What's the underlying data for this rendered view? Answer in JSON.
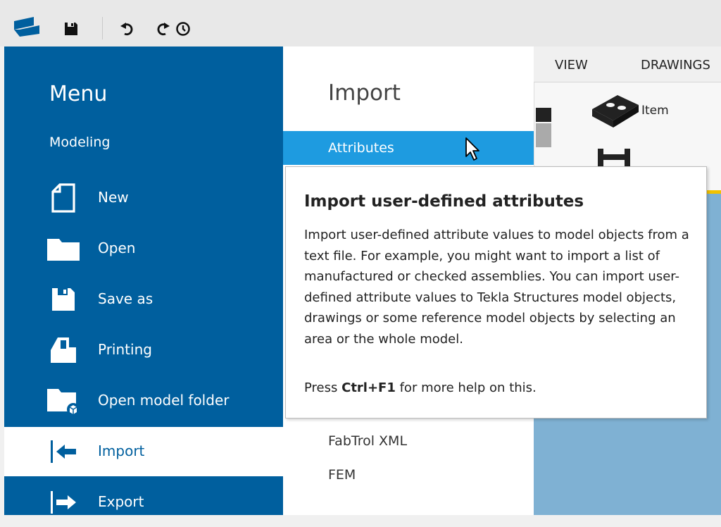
{
  "quick_access": {
    "logo": "tekla-logo-icon",
    "icons": [
      "save-icon",
      "undo-icon",
      "redo-icon",
      "history-icon"
    ]
  },
  "menu": {
    "title": "Menu",
    "subtitle": "Modeling",
    "items": [
      {
        "label": "New",
        "icon": "new-file-icon"
      },
      {
        "label": "Open",
        "icon": "folder-icon"
      },
      {
        "label": "Save as",
        "icon": "save-icon"
      },
      {
        "label": "Printing",
        "icon": "printer-icon"
      },
      {
        "label": "Open model folder",
        "icon": "model-folder-icon"
      },
      {
        "label": "Import",
        "icon": "import-arrow-icon",
        "active": true
      },
      {
        "label": "Export",
        "icon": "export-arrow-icon"
      }
    ]
  },
  "submenu": {
    "title": "Import",
    "items": [
      {
        "label": "Attributes",
        "highlighted": true
      },
      {
        "label": "FabTrol XML"
      },
      {
        "label": "FEM"
      }
    ]
  },
  "ribbon": {
    "tabs": [
      "VIEW",
      "DRAWINGS"
    ],
    "buttons": [
      {
        "label": "Item",
        "icon": "item-block-icon"
      }
    ]
  },
  "tooltip": {
    "title": "Import user-defined attributes",
    "body": "Import user-defined attribute values to model objects from a text file. For example, you might want to import a list of manufactured or checked assemblies. You can import user-defined attribute values to Tekla Structures model objects, drawings or some reference model objects by selecting an area or the whole model.",
    "help_prefix": "Press ",
    "help_key": "Ctrl+F1",
    "help_suffix": " for more help on this."
  },
  "colors": {
    "menu_bg": "#005f9e",
    "highlight": "#1e9be0",
    "ribbon_accent": "#f2c200",
    "model_area": "#7fb1d3"
  }
}
